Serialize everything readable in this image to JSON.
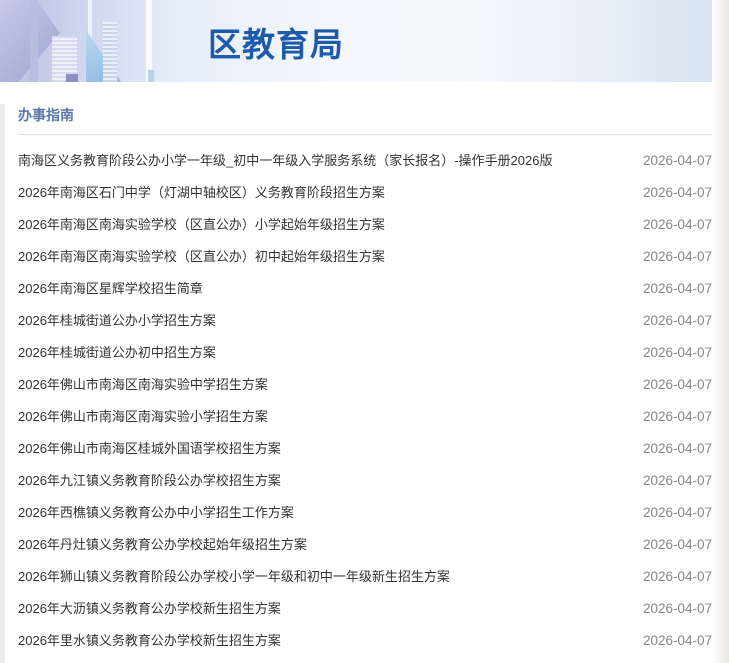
{
  "banner": {
    "title": "区教育局"
  },
  "section": {
    "title": "办事指南",
    "items": [
      {
        "title": "南海区义务教育阶段公办小学一年级_初中一年级入学服务系统（家长报名）-操作手册2026版",
        "date": "2026-04-07"
      },
      {
        "title": "2026年南海区石门中学（灯湖中轴校区）义务教育阶段招生方案",
        "date": "2026-04-07"
      },
      {
        "title": "2026年南海区南海实验学校（区直公办）小学起始年级招生方案",
        "date": "2026-04-07"
      },
      {
        "title": "2026年南海区南海实验学校（区直公办）初中起始年级招生方案",
        "date": "2026-04-07"
      },
      {
        "title": "2026年南海区星辉学校招生简章",
        "date": "2026-04-07"
      },
      {
        "title": "2026年桂城街道公办小学招生方案",
        "date": "2026-04-07"
      },
      {
        "title": "2026年桂城街道公办初中招生方案",
        "date": "2026-04-07"
      },
      {
        "title": "2026年佛山市南海区南海实验中学招生方案",
        "date": "2026-04-07"
      },
      {
        "title": "2026年佛山市南海区南海实验小学招生方案",
        "date": "2026-04-07"
      },
      {
        "title": "2026年佛山市南海区桂城外国语学校招生方案",
        "date": "2026-04-07"
      },
      {
        "title": "2026年九江镇义务教育阶段公办学校招生方案",
        "date": "2026-04-07"
      },
      {
        "title": "2026年西樵镇义务教育公办中小学招生工作方案",
        "date": "2026-04-07"
      },
      {
        "title": "2026年丹灶镇义务教育公办学校起始年级招生方案",
        "date": "2026-04-07"
      },
      {
        "title": "2026年狮山镇义务教育阶段公办学校小学一年级和初中一年级新生招生方案",
        "date": "2026-04-07"
      },
      {
        "title": "2026年大沥镇义务教育公办学校新生招生方案",
        "date": "2026-04-07"
      },
      {
        "title": "2026年里水镇义务教育公办学校新生招生方案",
        "date": "2026-04-07"
      }
    ]
  }
}
